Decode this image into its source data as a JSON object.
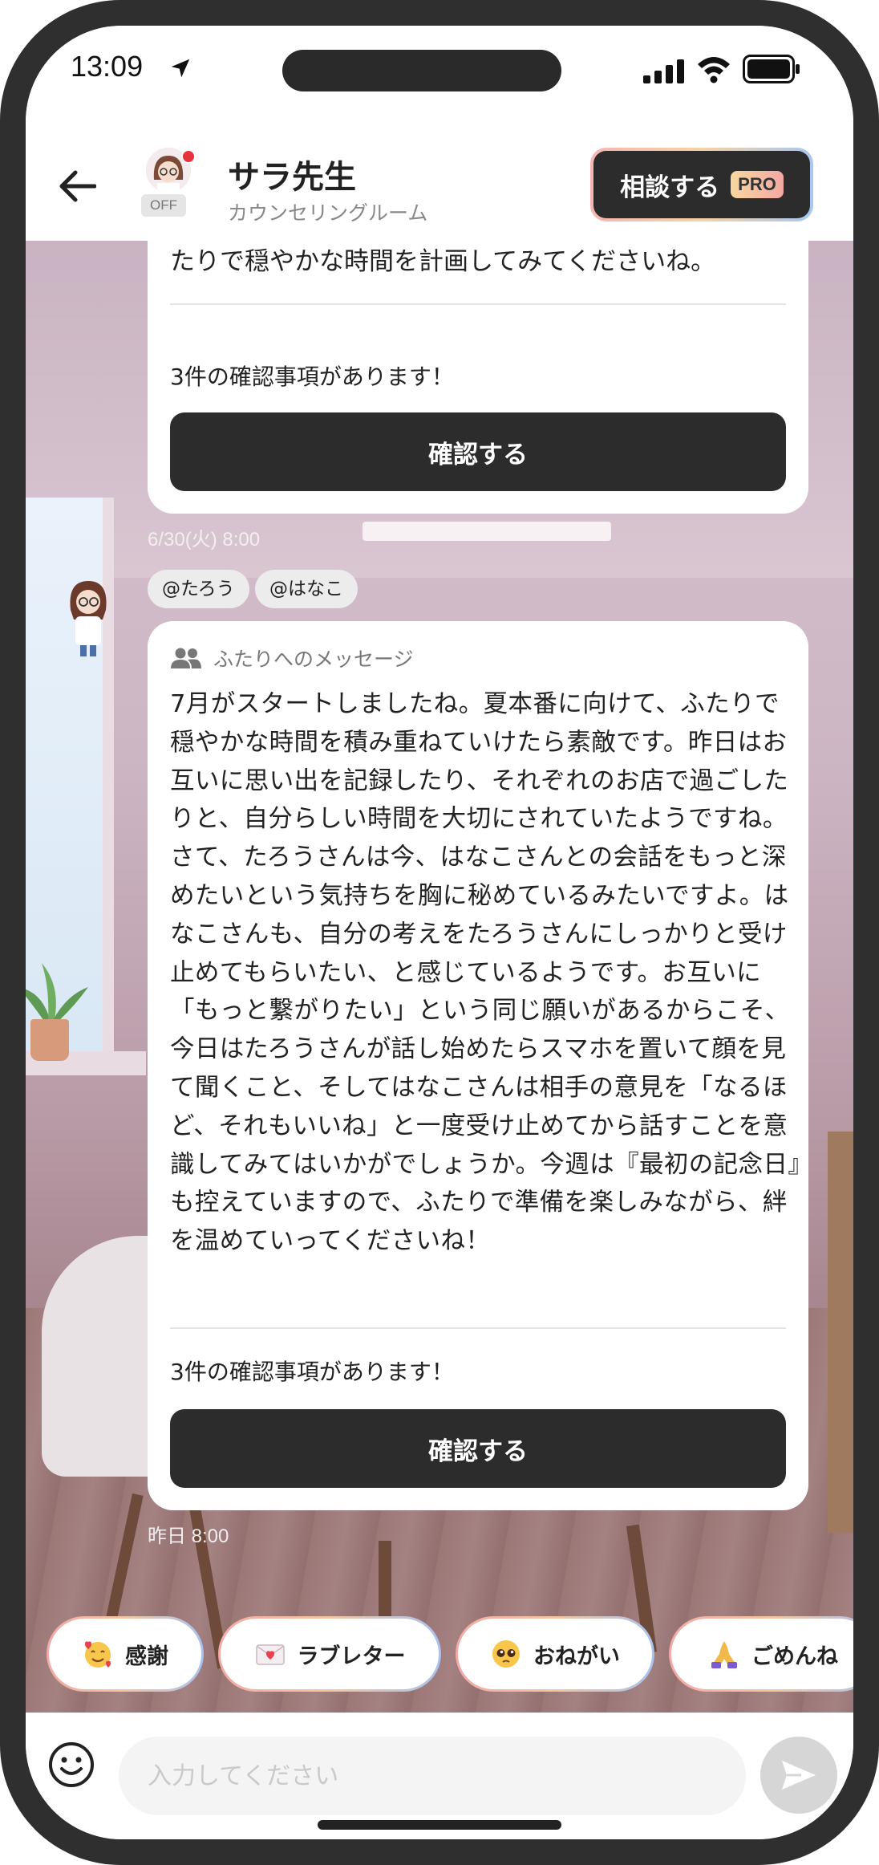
{
  "status_bar": {
    "time": "13:09"
  },
  "header": {
    "title": "サラ先生",
    "subtitle": "カウンセリングルーム",
    "status_badge": "OFF",
    "consult_label": "相談する",
    "pro_badge": "PRO"
  },
  "previous_message": {
    "tail_text": "たりで穏やかな時間を計画してみてくださいね。",
    "notice": "3件の確認事項があります！",
    "confirm_label": "確認する",
    "timestamp": "6/30(火) 8:00"
  },
  "mentions": [
    "@たろう",
    "@はなこ"
  ],
  "message": {
    "header_label": "ふたりへのメッセージ",
    "body": "7月がスタートしましたね。夏本番に向けて、ふたりで穏やかな時間を積み重ねていけたら素敵です。昨日はお互いに思い出を記録したり、それぞれのお店で過ごしたりと、自分らしい時間を大切にされていたようですね。さて、たろうさんは今、はなこさんとの会話をもっと深めたいという気持ちを胸に秘めているみたいですよ。はなこさんも、自分の考えをたろうさんにしっかりと受け止めてもらいたい、と感じているようです。お互いに「もっと繋がりたい」という同じ願いがあるからこそ、今日はたろうさんが話し始めたらスマホを置いて顔を見て聞くこと、そしてはなこさんは相手の意見を「なるほど、それもいいね」と一度受け止めてから話すことを意識してみてはいかがでしょうか。今週は『最初の記念日』も控えていますので、ふたりで準備を楽しみながら、絆を温めていってくださいね！",
    "notice": "3件の確認事項があります！",
    "confirm_label": "確認する",
    "timestamp": "昨日 8:00"
  },
  "chips": [
    {
      "label": "感謝",
      "icon": "smiling-hearts-icon"
    },
    {
      "label": "ラブレター",
      "icon": "love-letter-icon"
    },
    {
      "label": "おねがい",
      "icon": "pleading-face-icon"
    },
    {
      "label": "ごめんね",
      "icon": "folded-hands-icon"
    }
  ],
  "input": {
    "placeholder": "入力してください",
    "value": ""
  }
}
